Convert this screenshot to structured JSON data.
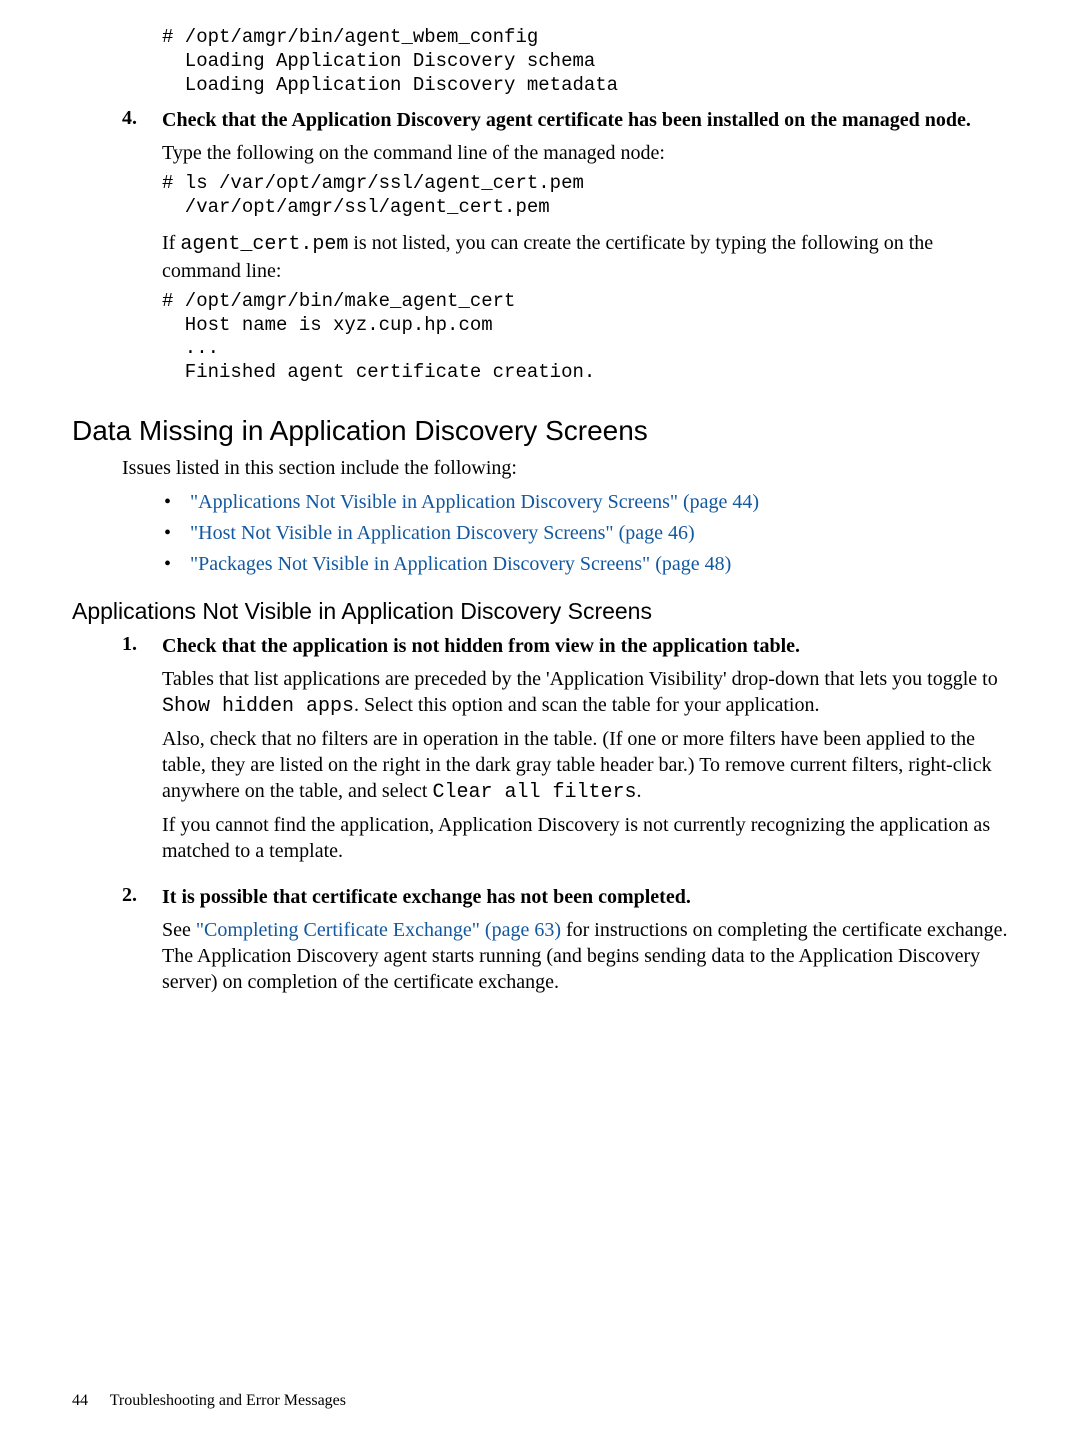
{
  "top_indent": {
    "code1": "# /opt/amgr/bin/agent_wbem_config\n  Loading Application Discovery schema\n  Loading Application Discovery metadata",
    "step4_num": "4.",
    "step4_title": "Check that the Application Discovery agent certificate has been installed on the managed node.",
    "step4_p1": "Type the following on the command line of the managed node:",
    "step4_code1": "# ls /var/opt/amgr/ssl/agent_cert.pem\n  /var/opt/amgr/ssl/agent_cert.pem",
    "step4_p2a": "If ",
    "step4_p2_code": "agent_cert.pem",
    "step4_p2b": " is not listed, you can create the certificate by typing the following on the command line:",
    "step4_code2": "# /opt/amgr/bin/make_agent_cert\n  Host name is xyz.cup.hp.com\n  ...\n  Finished agent certificate creation."
  },
  "section_title": "Data Missing in Application Discovery Screens",
  "section_intro": "Issues listed in this section include the following:",
  "links": [
    "\"Applications Not Visible in Application Discovery Screens\" (page 44)",
    "\"Host Not Visible in Application Discovery Screens\" (page 46)",
    "\"Packages Not Visible in Application Discovery Screens\" (page 48)"
  ],
  "subsection_title": "Applications Not Visible in Application Discovery Screens",
  "s1": {
    "num": "1.",
    "title": "Check that the application is not hidden from view in the application table.",
    "p1a": "Tables that list applications are preceded by the 'Application Visibility' drop-down that lets you toggle to ",
    "p1_code": "Show hidden apps",
    "p1b": ". Select this option and scan the table for your application.",
    "p2a": "Also, check that no filters are in operation in the table. (If one or more filters have been applied to the table, they are listed on the right in the dark gray table header bar.) To remove current filters, right-click anywhere on the table, and select ",
    "p2_code": "Clear all filters",
    "p2b": ".",
    "p3": "If you cannot find the application, Application Discovery is not currently recognizing the application as matched to a template."
  },
  "s2": {
    "num": "2.",
    "title": "It is possible that certificate exchange has not been completed.",
    "p1a": "See ",
    "p1_link": "\"Completing Certificate Exchange\" (page 63)",
    "p1b": " for instructions on completing the certificate exchange. The Application Discovery agent starts running (and begins sending data to the Application Discovery server) on completion of the certificate exchange."
  },
  "footer": {
    "page": "44",
    "chapter": "Troubleshooting and Error Messages"
  }
}
